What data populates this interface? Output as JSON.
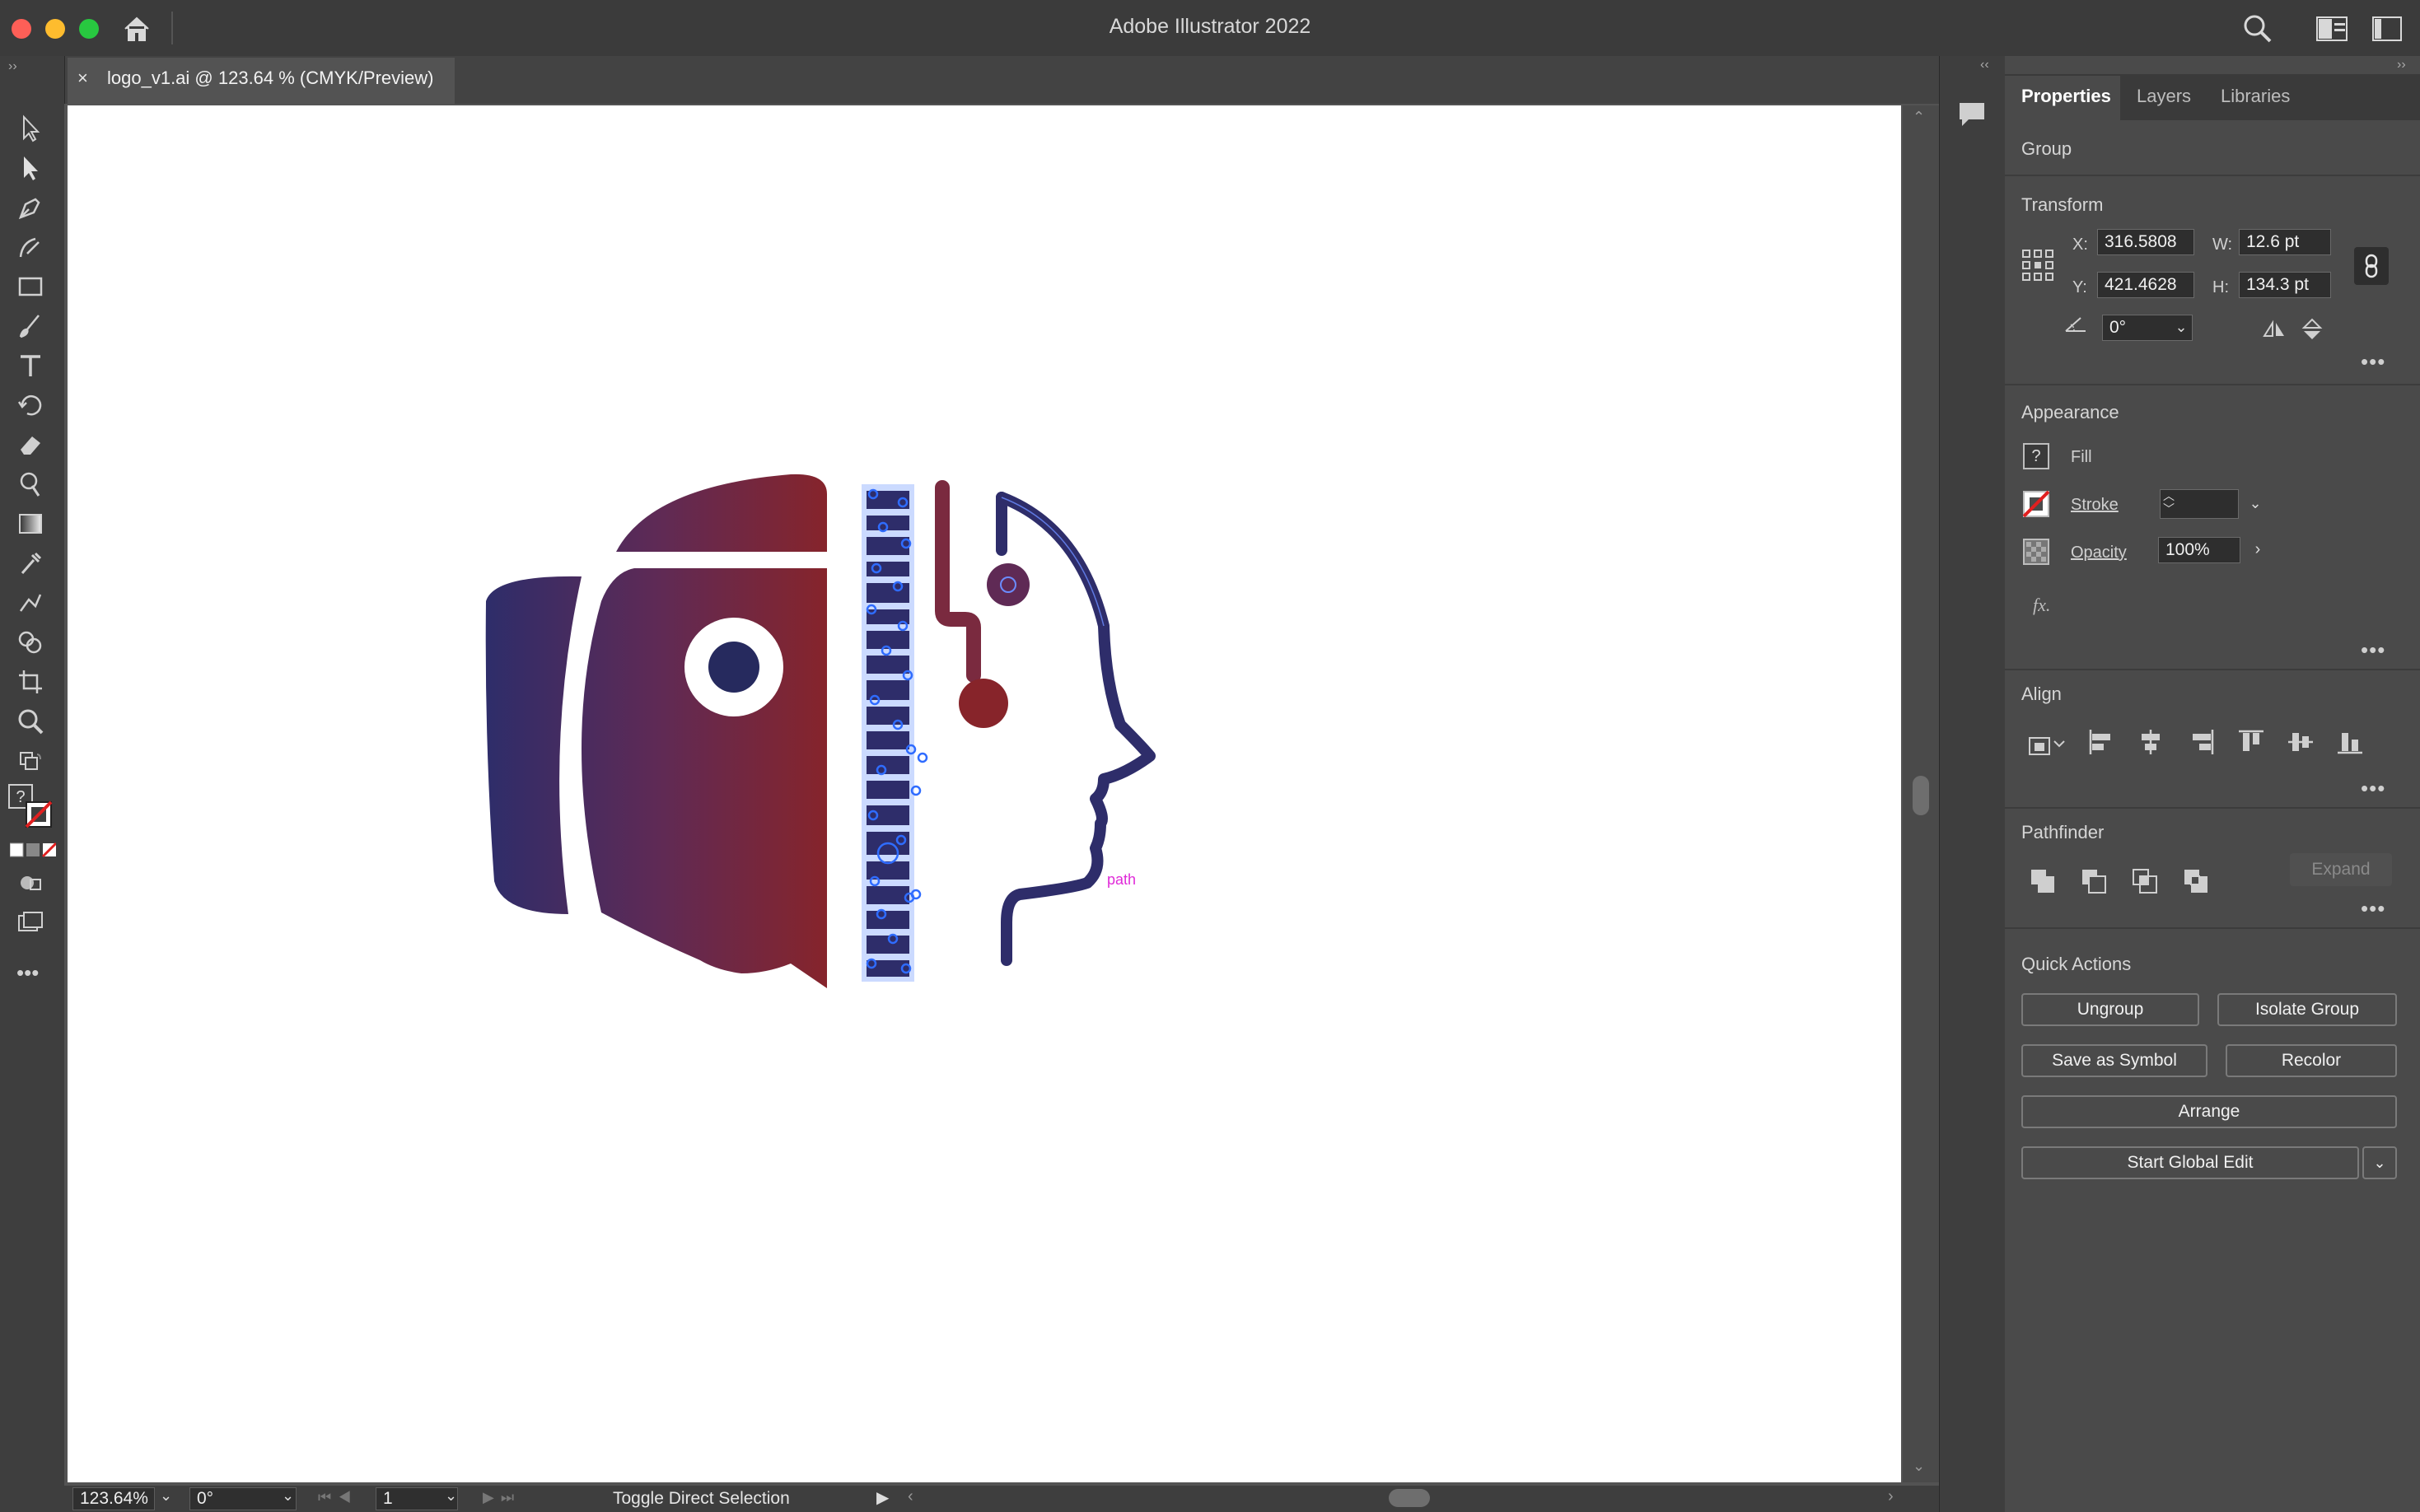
{
  "app": {
    "title": "Adobe Illustrator 2022"
  },
  "document": {
    "tab_label": "logo_v1.ai @ 123.64 % (CMYK/Preview)",
    "close_glyph": "×"
  },
  "artwork": {
    "hover_label": "path",
    "colors": {
      "gradient_start": "#2e2d6a",
      "gradient_end": "#87242a",
      "selection": "#2f6cff"
    }
  },
  "status": {
    "zoom": "123.64%",
    "rotation": "0°",
    "artboard": "1",
    "message": "Toggle Direct Selection"
  },
  "panel": {
    "tabs": [
      "Properties",
      "Layers",
      "Libraries"
    ],
    "selection_type": "Group",
    "transform": {
      "title": "Transform",
      "x_label": "X:",
      "x": "316.5808",
      "y_label": "Y:",
      "y": "421.4628",
      "w_label": "W:",
      "w": "12.6 pt",
      "h_label": "H:",
      "h": "134.3 pt",
      "angle": "0°"
    },
    "appearance": {
      "title": "Appearance",
      "fill_label": "Fill",
      "fill_swatch": "?",
      "stroke_label": "Stroke",
      "opacity_label": "Opacity",
      "opacity": "100%",
      "fx": "fx."
    },
    "align": {
      "title": "Align"
    },
    "pathfinder": {
      "title": "Pathfinder",
      "expand": "Expand"
    },
    "quick_actions": {
      "title": "Quick Actions",
      "ungroup": "Ungroup",
      "isolate": "Isolate Group",
      "save_symbol": "Save as Symbol",
      "recolor": "Recolor",
      "arrange": "Arrange",
      "global_edit": "Start Global Edit"
    }
  },
  "toolbar": {
    "fill_swatch": "?"
  },
  "icons": [
    "home-icon",
    "search-icon",
    "workspace-icon",
    "panel-toggle-icon",
    "comments-icon",
    "constrain-link-icon"
  ]
}
